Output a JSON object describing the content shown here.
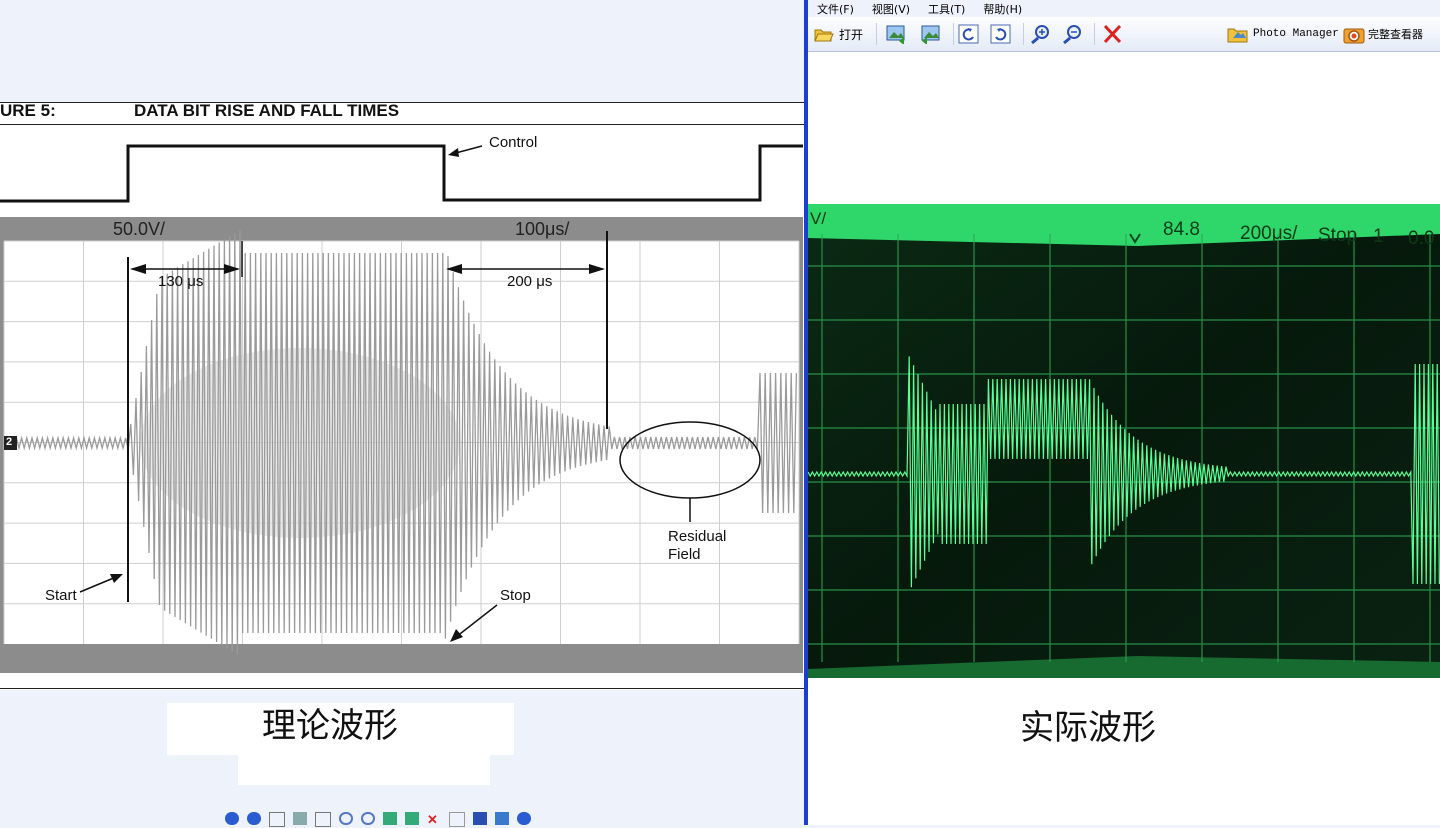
{
  "left": {
    "figure_label": "URE 5:",
    "figure_title": "DATA BIT RISE AND FALL TIMES",
    "volt_div": "50.0V/",
    "time_div": "100μs/",
    "channel": "2",
    "annotations": {
      "control": "Control",
      "t130": "130 μs",
      "t200": "200 μs",
      "residual1": "Residual",
      "residual2": "Field",
      "start": "Start",
      "stop": "Stop"
    },
    "caption": "理论波形"
  },
  "right": {
    "menu": [
      "文件(F)",
      "视图(V)",
      "工具(T)",
      "帮助(H)"
    ],
    "toolbar": {
      "open_label": "打开",
      "photo_manager_label": "Photo Manager",
      "full_viewer_label": "完整查看器"
    },
    "scope": {
      "left_label": "V/",
      "trigger_pos": "84.8",
      "time_div": "200μs/",
      "state": "Stop",
      "trigger_ch": "1",
      "right_value": "0.0"
    },
    "caption": "实际波形"
  },
  "colors": {
    "divider": "#1b3fd0",
    "scope_green": "#3cff80",
    "scope_bg": "#07200f"
  }
}
